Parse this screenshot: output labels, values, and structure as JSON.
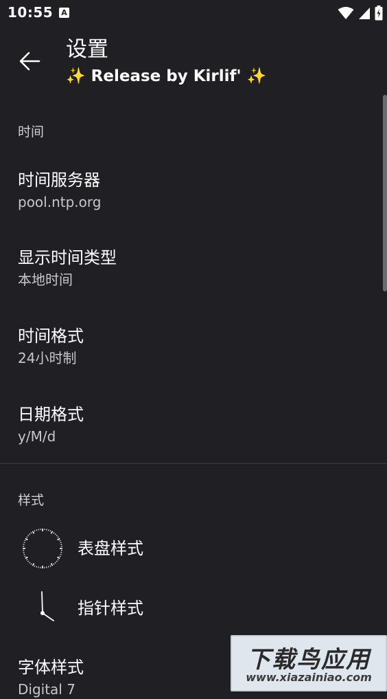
{
  "status_bar": {
    "time": "10:55",
    "notification_icon": "A"
  },
  "app_bar": {
    "title": "设置",
    "subtitle": "✨ Release by Kirlif' ✨"
  },
  "sections": {
    "time": {
      "header": "时间",
      "items": [
        {
          "title": "时间服务器",
          "summary": "pool.ntp.org"
        },
        {
          "title": "显示时间类型",
          "summary": "本地时间"
        },
        {
          "title": "时间格式",
          "summary": "24小时制"
        },
        {
          "title": "日期格式",
          "summary": "y/M/d"
        }
      ]
    },
    "style": {
      "header": "样式",
      "items": [
        {
          "title": "表盘样式",
          "icon": "dial-icon"
        },
        {
          "title": "指针样式",
          "icon": "clock-hand-icon"
        },
        {
          "title": "字体样式",
          "summary": "Digital 7"
        }
      ]
    }
  },
  "watermark": {
    "main": "下载鸟应用",
    "url": "www.xiazainiao.com"
  },
  "colors": {
    "background": "#1f1f24",
    "text": "#ffffff",
    "secondary_text": "#c8c8cc",
    "accent_sparkle": "#f5d04a"
  }
}
